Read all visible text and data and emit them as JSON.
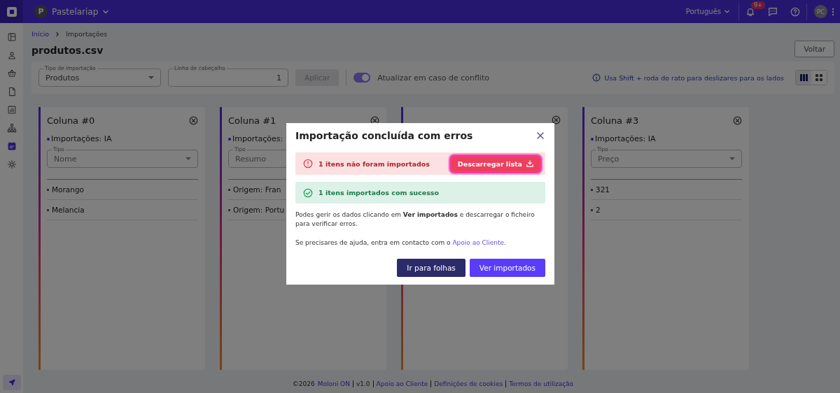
{
  "topbar": {
    "company_initial": "P",
    "company": "Pastelariap",
    "language": "Português",
    "notifications_badge": "9+",
    "avatar_initials": "PC"
  },
  "sidebar": {
    "items": [
      {
        "kind": "dashboard",
        "selected": false
      },
      {
        "kind": "person",
        "selected": false
      },
      {
        "kind": "basket",
        "selected": false
      },
      {
        "kind": "document",
        "selected": false
      },
      {
        "kind": "chart",
        "selected": false
      },
      {
        "kind": "hierarchy",
        "selected": false
      },
      {
        "kind": "calendar",
        "selected": true
      },
      {
        "kind": "gear",
        "selected": false
      }
    ]
  },
  "breadcrumb": [
    "Início",
    "Importações"
  ],
  "page_title": "produtos.csv",
  "back_button": "Voltar",
  "filters": {
    "import_type": {
      "label": "Tipo de importação",
      "value": "Produtos"
    },
    "header_line": {
      "label": "Linha de cabeçalho",
      "value": "1"
    },
    "apply_button": "Aplicar",
    "update_on_conflict": {
      "label": "Atualizar em caso de conflito",
      "checked": true
    },
    "hint": "Usa Shift + roda do rato para deslizares para os lados",
    "views": [
      {
        "kind": "columns",
        "selected": true
      },
      {
        "kind": "grid",
        "selected": false
      }
    ]
  },
  "columns": [
    {
      "title": "Coluna #0",
      "source": "Importações: IA",
      "type_label": "Tipo",
      "type": "Nome",
      "values": [
        "Morango",
        "Melancia"
      ]
    },
    {
      "title": "Coluna #1",
      "source": "Importações:",
      "type_label": "Tipo",
      "type": "Resumo",
      "values": [
        "Origem: Fran",
        "Origem: Portu"
      ]
    },
    {},
    {
      "title": "Coluna #3",
      "source": "Importações: IA",
      "type_label": "Tipo",
      "type": "Preço",
      "values": [
        "321",
        "2"
      ]
    }
  ],
  "footer": {
    "copyright": "©2026",
    "brand": "Moloni ON",
    "version": "v1.0",
    "links": [
      "Apoio ao Cliente",
      "Definições de cookies",
      "Termos de utilização"
    ]
  },
  "dialog": {
    "title": "Importação concluída com erros",
    "error": "1 itens não foram importados",
    "download_button": "Descarregar lista",
    "success": "1 itens importados com sucesso",
    "body": "Podes gerir os dados clicando em **Ver importados** e descarregar o ficheiro para verificar erros.",
    "help_prefix": "Se precisares de ajuda, entra em contacto com o ",
    "help_link": "Apoio ao Cliente",
    "help_suffix": ".",
    "secondary_button": "Ir para folhas",
    "primary_button": "Ver importados"
  }
}
